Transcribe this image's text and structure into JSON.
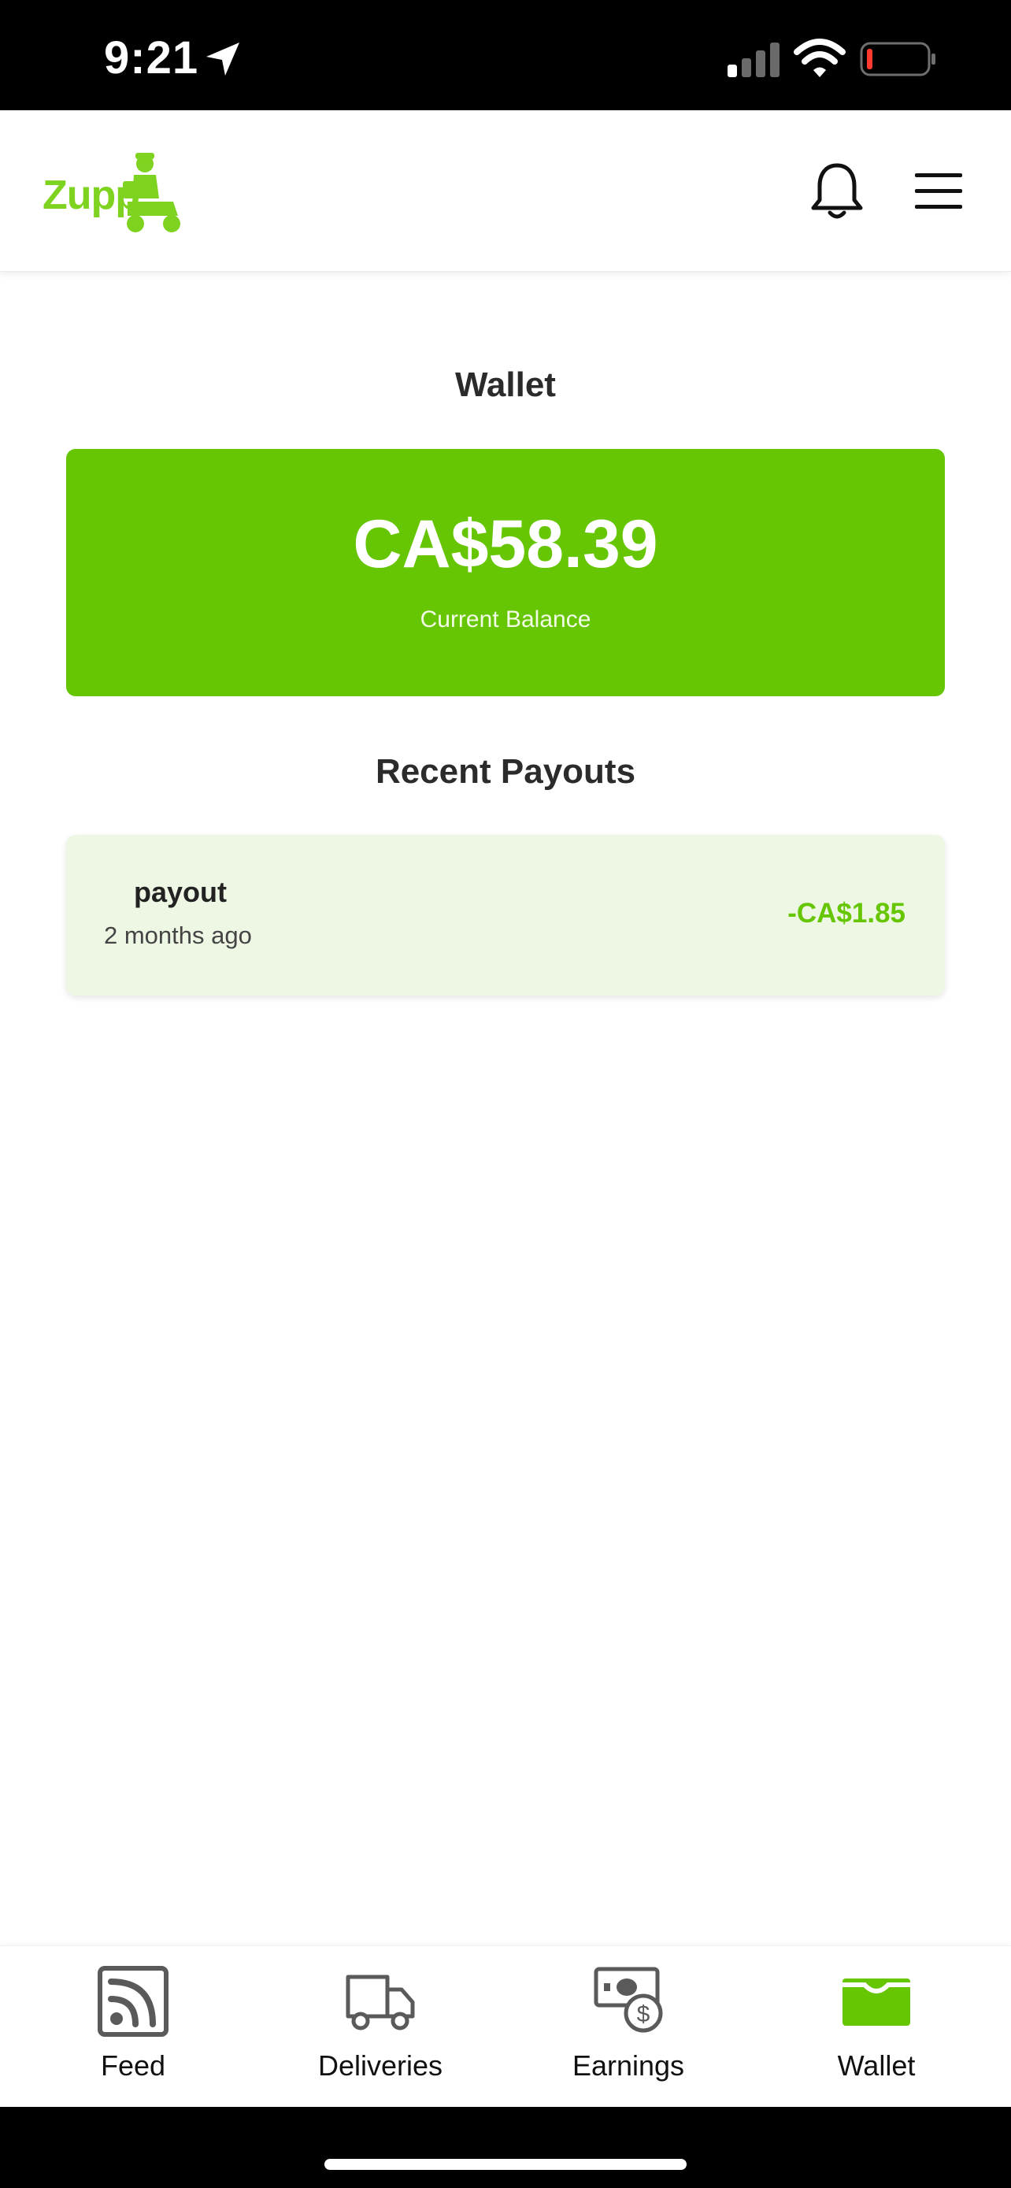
{
  "status_bar": {
    "time": "9:21",
    "icons": [
      "location-arrow-icon",
      "cellular-signal-icon",
      "wifi-icon",
      "battery-low-icon"
    ]
  },
  "header": {
    "logo_text": "Zupp",
    "brand_color": "#7ed321",
    "icons": [
      "bell-icon",
      "hamburger-menu-icon"
    ]
  },
  "wallet": {
    "title": "Wallet",
    "balance": "CA$58.39",
    "balance_label": "Current Balance",
    "card_color": "#66c604"
  },
  "payouts": {
    "title": "Recent Payouts",
    "items": [
      {
        "type": "payout",
        "time": "2 months ago",
        "amount": "-CA$1.85"
      }
    ]
  },
  "tabbar": {
    "active_tab": "Wallet",
    "active_color": "#66c604",
    "items": [
      {
        "label": "Feed",
        "icon": "rss-feed-icon"
      },
      {
        "label": "Deliveries",
        "icon": "truck-icon"
      },
      {
        "label": "Earnings",
        "icon": "money-bill-icon"
      },
      {
        "label": "Wallet",
        "icon": "wallet-icon"
      }
    ]
  }
}
